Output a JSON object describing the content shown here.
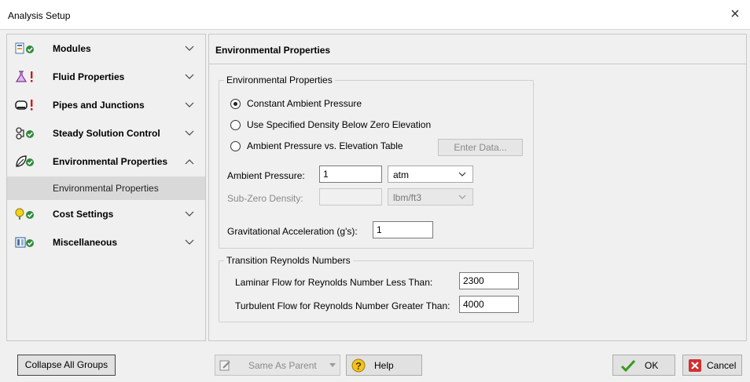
{
  "window": {
    "title": "Analysis Setup",
    "close_glyph": "×"
  },
  "sidebar": {
    "groups": [
      {
        "label": "Modules",
        "icon": "modules-icon",
        "status": "ok"
      },
      {
        "label": "Fluid Properties",
        "icon": "flask-icon",
        "status": "warning"
      },
      {
        "label": "Pipes and Junctions",
        "icon": "pipe-icon",
        "status": "warning"
      },
      {
        "label": "Steady Solution Control",
        "icon": "solution-icon",
        "status": "ok"
      },
      {
        "label": "Environmental Properties",
        "icon": "leaf-icon",
        "status": "ok",
        "expanded": true
      },
      {
        "label": "Cost Settings",
        "icon": "cost-icon",
        "status": "ok"
      },
      {
        "label": "Miscellaneous",
        "icon": "misc-icon",
        "status": "ok"
      }
    ],
    "subitem": "Environmental Properties"
  },
  "panel": {
    "title": "Environmental Properties",
    "env_group": {
      "legend": "Environmental Properties",
      "radio_constant": "Constant Ambient Pressure",
      "radio_density": "Use Specified Density Below Zero Elevation",
      "radio_table": "Ambient Pressure vs. Elevation Table",
      "selected": "radio_constant",
      "enter_data_label": "Enter Data...",
      "ambient_pressure_label": "Ambient Pressure:",
      "ambient_pressure_value": "1",
      "ambient_pressure_unit": "atm",
      "subzero_label": "Sub-Zero Density:",
      "subzero_value": "",
      "subzero_unit": "lbm/ft3",
      "gravity_label": "Gravitational Acceleration (g's):",
      "gravity_value": "1"
    },
    "reynolds_group": {
      "legend": "Transition Reynolds Numbers",
      "laminar_label": "Laminar Flow for Reynolds Number Less Than:",
      "laminar_value": "2300",
      "turbulent_label": "Turbulent Flow for Reynolds Number Greater Than:",
      "turbulent_value": "4000"
    }
  },
  "footer": {
    "collapse_label": "Collapse All Groups",
    "same_as_parent_label": "Same As Parent",
    "help_label": "Help",
    "ok_label": "OK",
    "cancel_label": "Cancel"
  },
  "colors": {
    "ok_green": "#2e8b3a",
    "warning_red": "#d11a1a",
    "cancel_red": "#d32f2f"
  }
}
